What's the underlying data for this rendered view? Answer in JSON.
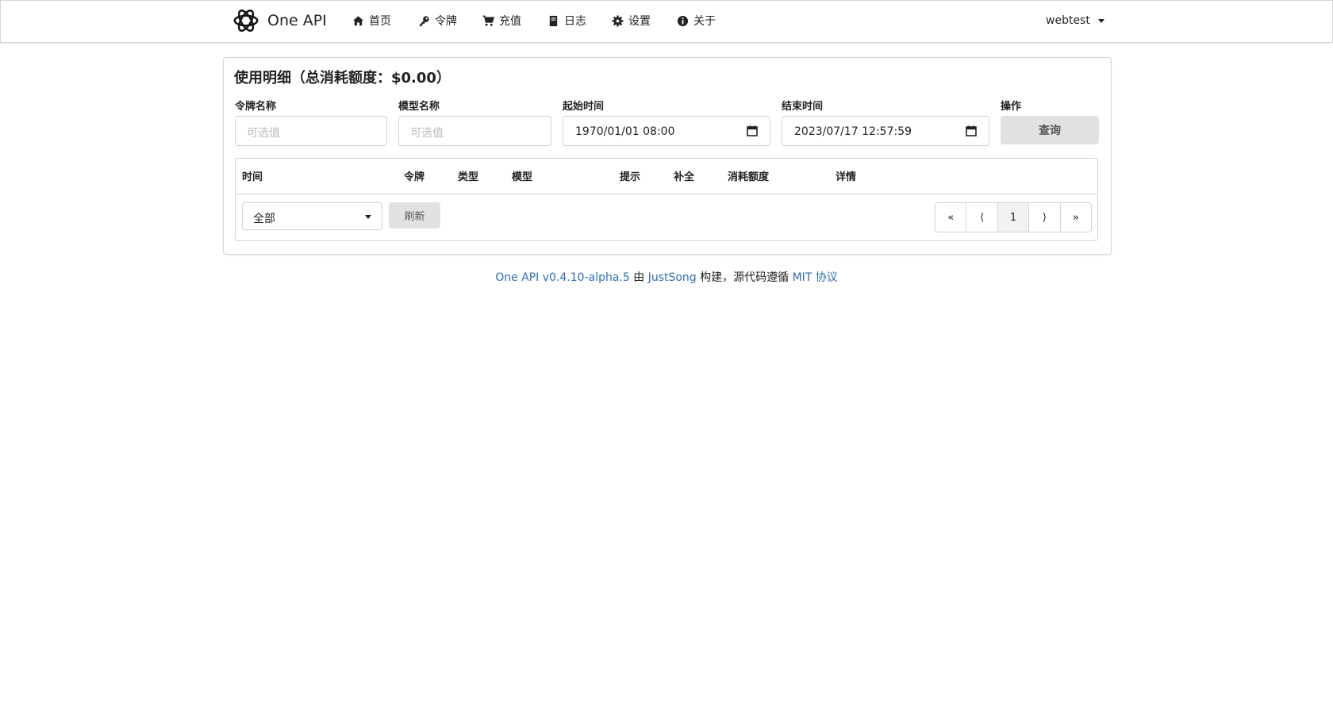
{
  "header": {
    "brand": "One API",
    "nav": [
      {
        "label": "首页",
        "icon": "home-icon"
      },
      {
        "label": "令牌",
        "icon": "key-icon"
      },
      {
        "label": "充值",
        "icon": "cart-icon"
      },
      {
        "label": "日志",
        "icon": "book-icon"
      },
      {
        "label": "设置",
        "icon": "gear-icon"
      },
      {
        "label": "关于",
        "icon": "info-icon"
      }
    ],
    "user": "webtest"
  },
  "page": {
    "title": "使用明细（总消耗额度：$0.00）"
  },
  "filters": {
    "token_label": "令牌名称",
    "token_placeholder": "可选值",
    "model_label": "模型名称",
    "model_placeholder": "可选值",
    "start_label": "起始时间",
    "start_value": "1970/01/01 08:00",
    "end_label": "结束时间",
    "end_value": "2023/07/17 12:57:59",
    "action_label": "操作",
    "query_button": "查询"
  },
  "table": {
    "columns": [
      "时间",
      "令牌",
      "类型",
      "模型",
      "提示",
      "补全",
      "消耗额度",
      "详情"
    ]
  },
  "controls": {
    "type_select": "全部",
    "refresh_button": "刷新"
  },
  "pagination": {
    "first": "«",
    "prev": "⟨",
    "current": "1",
    "next": "⟩",
    "last": "»"
  },
  "footer": {
    "version_link": "One API v0.4.10-alpha.5",
    "by": " 由 ",
    "author_link": "JustSong",
    "built": " 构建，源代码遵循 ",
    "license_link": "MIT 协议"
  }
}
